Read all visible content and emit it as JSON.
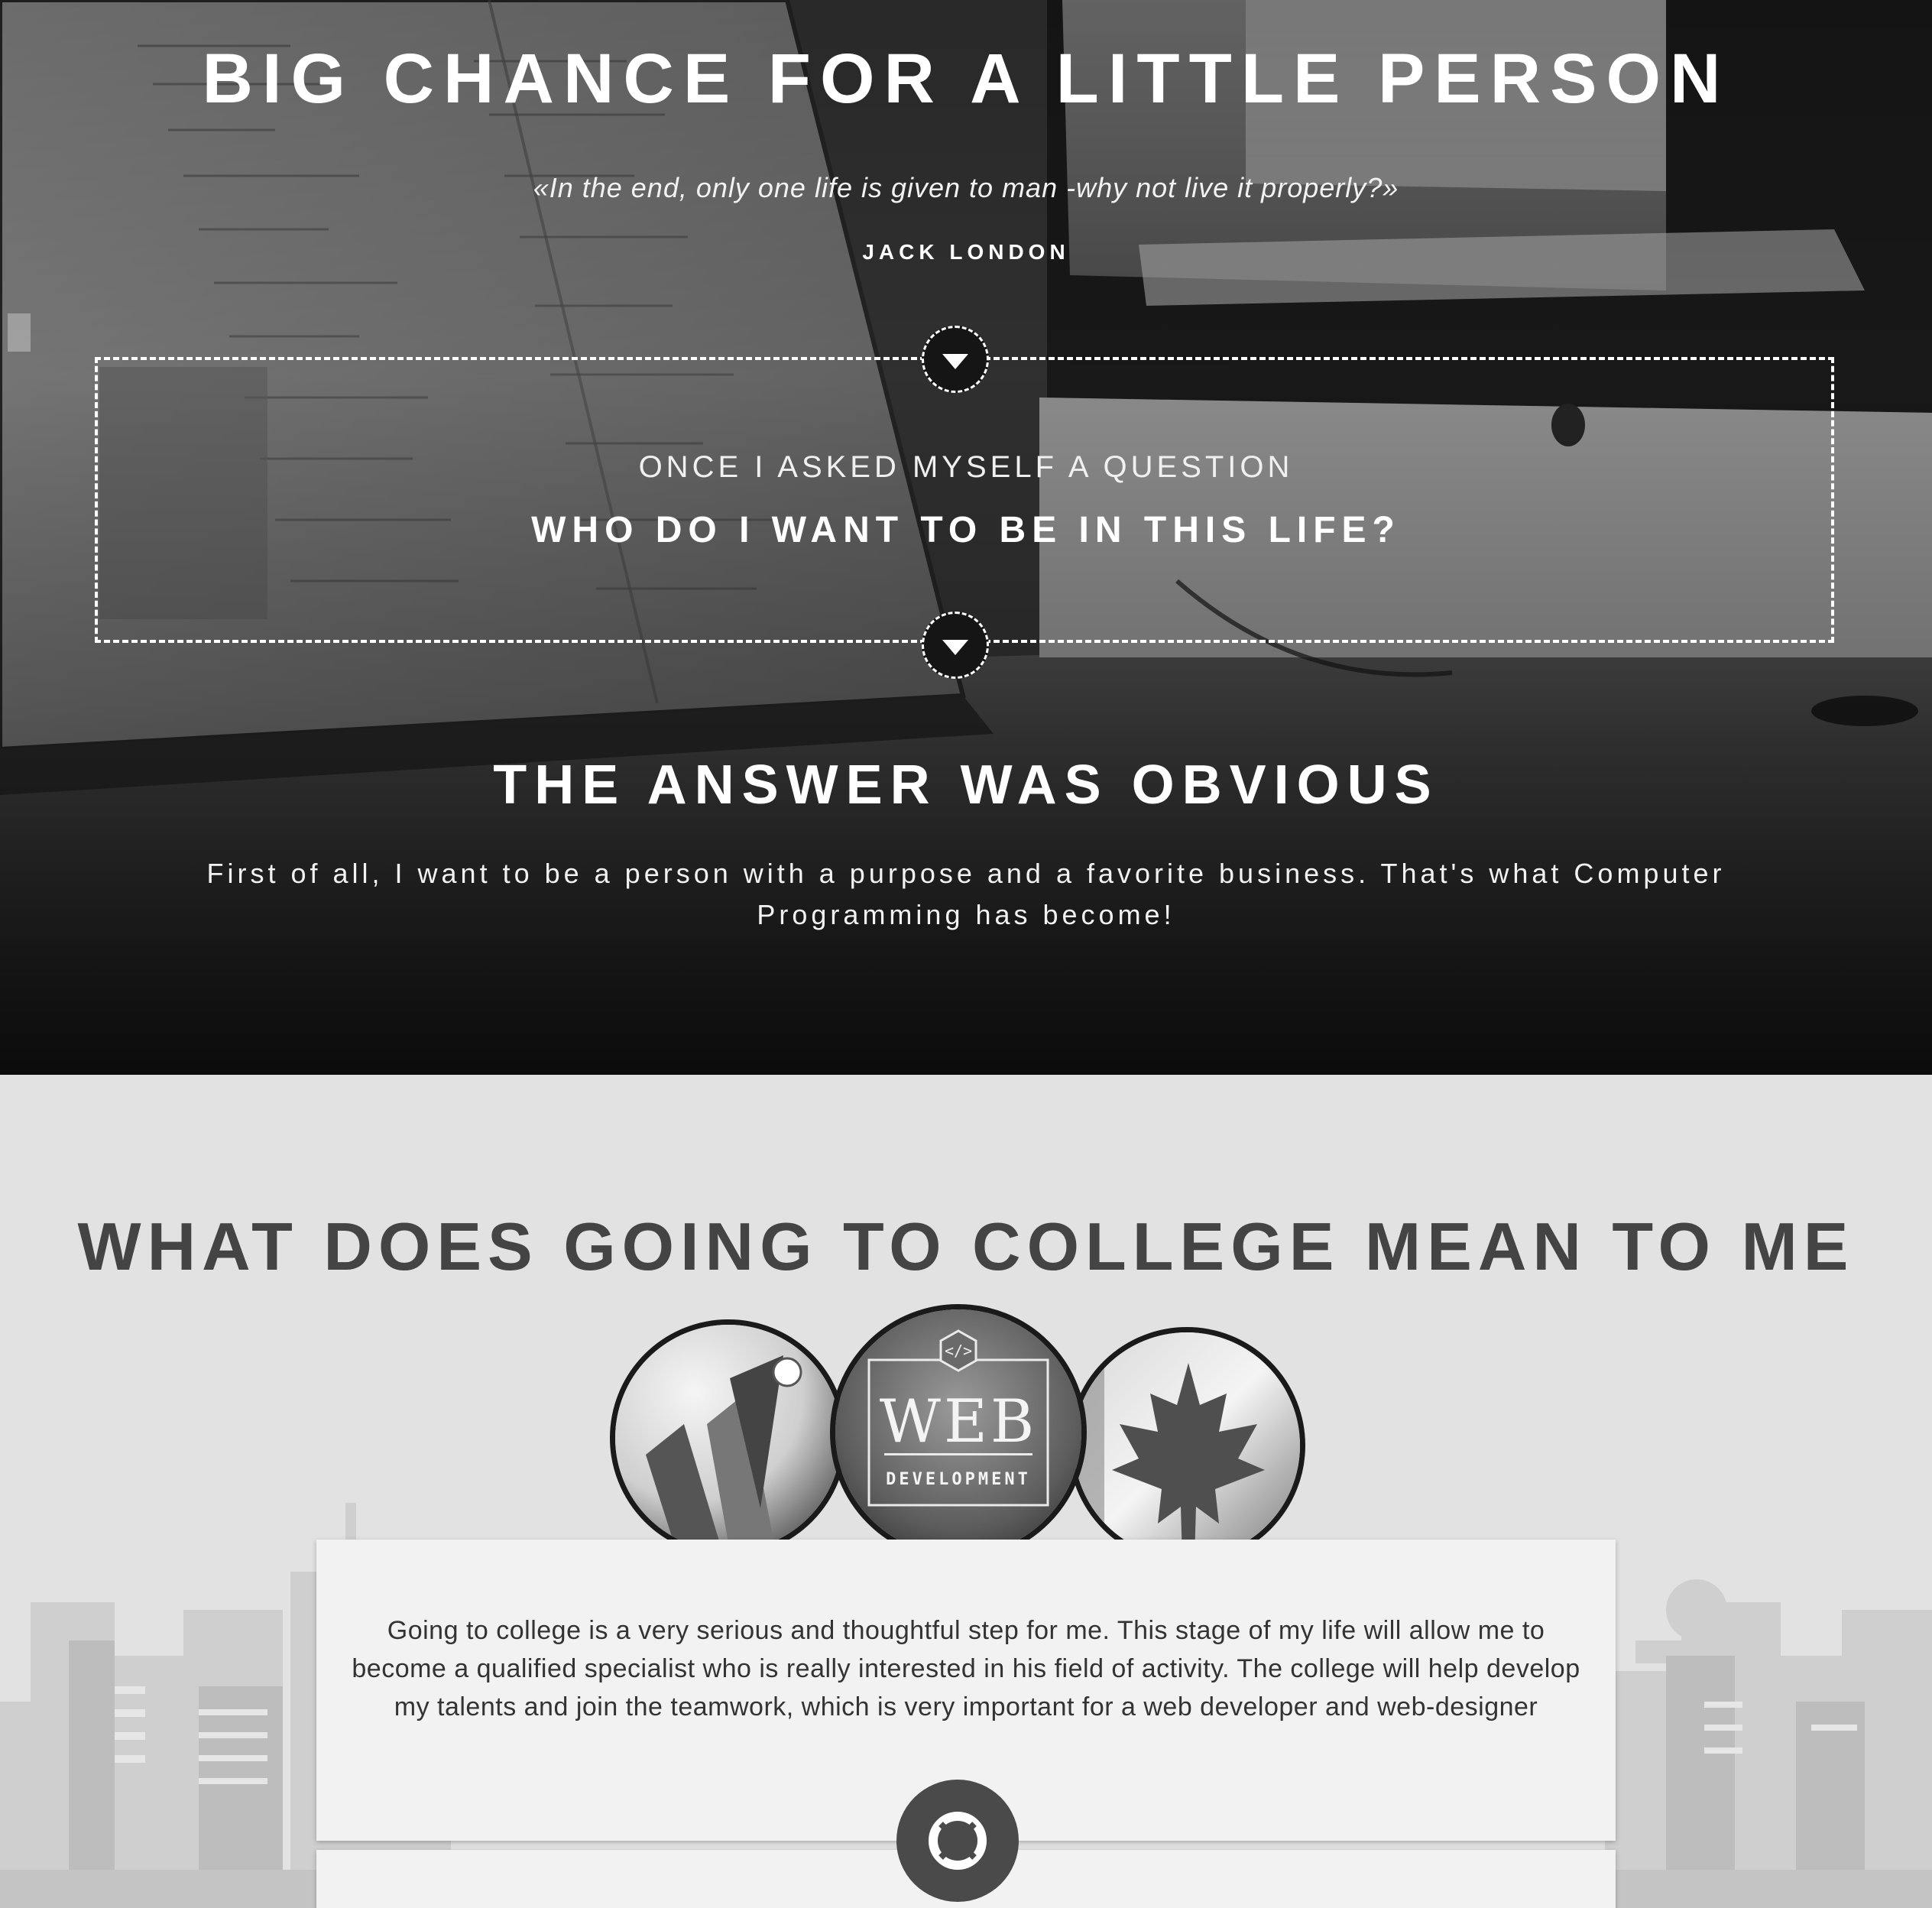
{
  "hero": {
    "title": "BIG CHANCE FOR A LITTLE PERSON",
    "quote": "«In the end, only one life is given to man -why not live it properly?»",
    "author": "JACK LONDON",
    "question_kicker": "ONCE I ASKED MYSELF A QUESTION",
    "question": "WHO DO I WANT TO BE IN THIS LIFE?",
    "answer_title": "THE ANSWER WAS OBVIOUS",
    "answer_text": "First of all, I want to be a person with a purpose and a favorite business. That's what Computer Programming has become!"
  },
  "college": {
    "title": "WHAT DOES GOING TO COLLEGE MEAN TO ME",
    "badges": [
      {
        "name": "yii-logo-badge"
      },
      {
        "name": "web-development-badge",
        "label_big": "WEB",
        "label_small": "DEVELOPMENT",
        "code_symbol": "</>"
      },
      {
        "name": "canada-flag-badge"
      }
    ],
    "card_text": "Going to college is a very serious and thoughtful step for me. This stage of my life will allow me to become a qualified specialist who is really interested in his field of activity. The college will help develop my talents and join the teamwork, which is very important for a web developer and web-designer"
  },
  "icons": {
    "scroll_down_1": "triangle-down-icon",
    "scroll_down_2": "triangle-down-icon",
    "help": "lifebuoy-icon"
  },
  "colors": {
    "hero_overlay": "#1f1f1f",
    "section_bg": "#e2e2e2",
    "heading_dark": "#444444",
    "card_bg": "#f2f2f2"
  }
}
